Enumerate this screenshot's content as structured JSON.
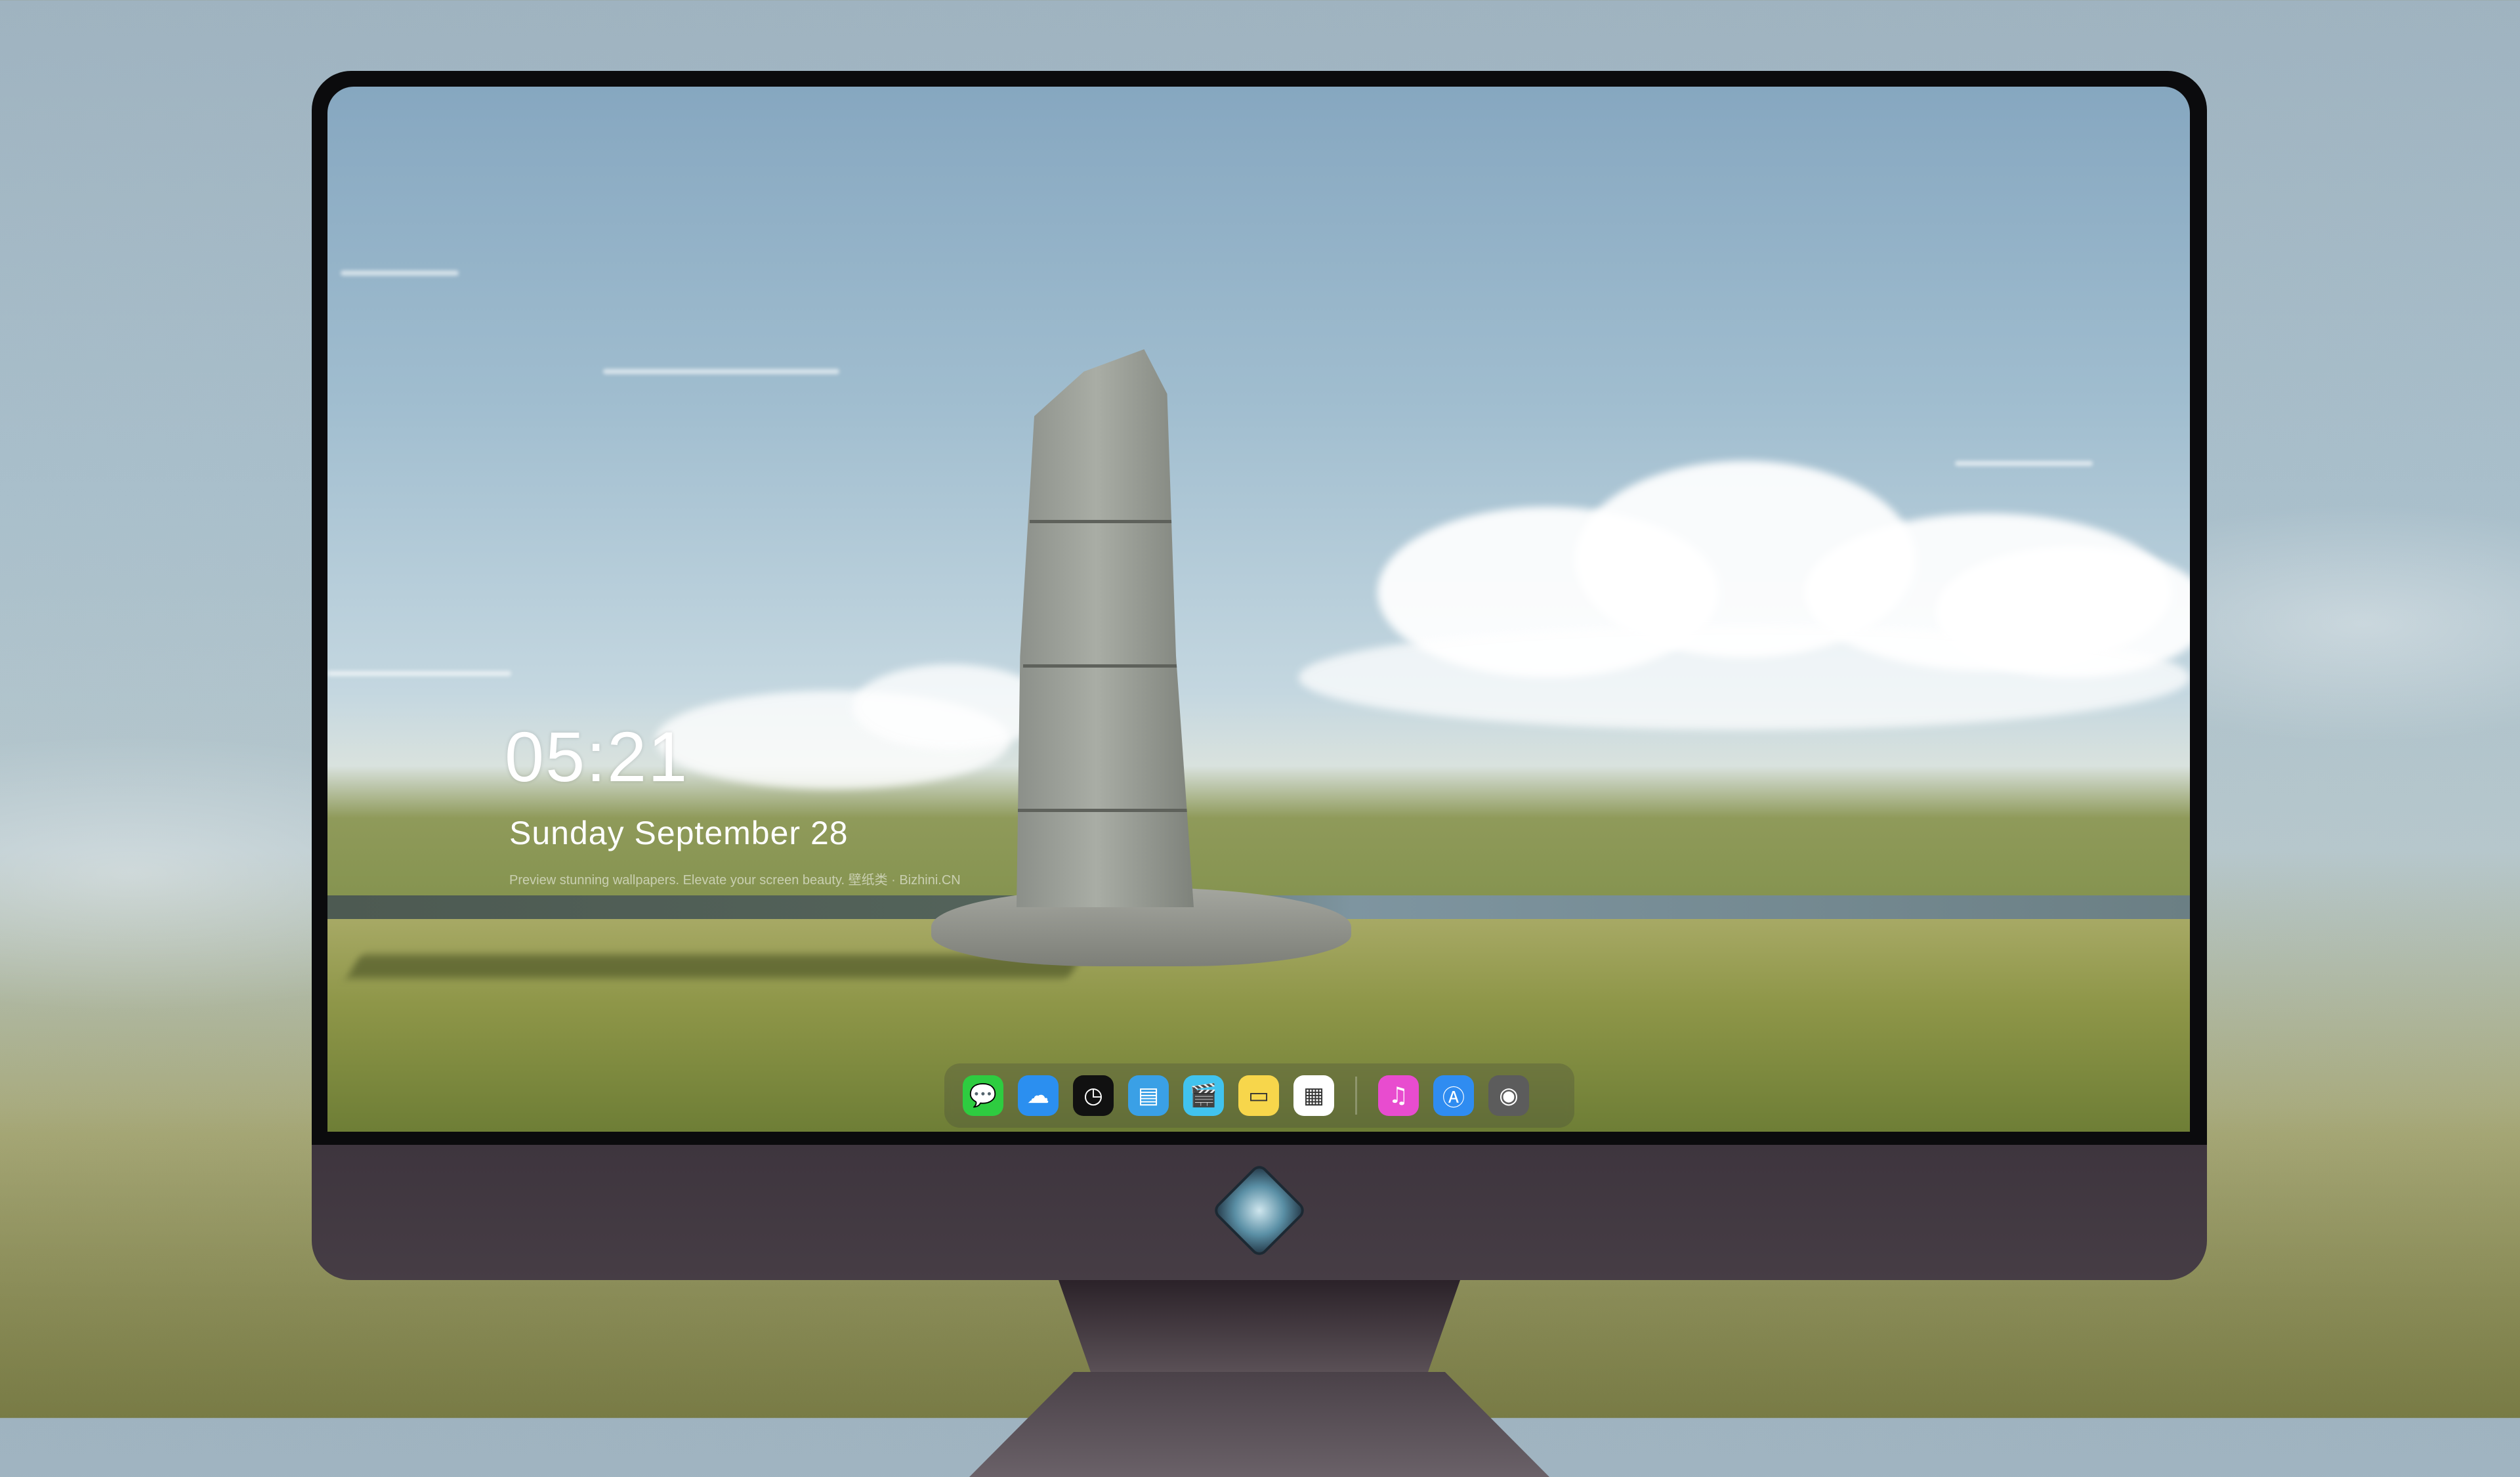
{
  "lockscreen": {
    "time": "05:21",
    "date": "Sunday September  28",
    "tagline": "Preview stunning wallpapers. Elevate your screen beauty. 壁纸类 · Bizhini.CN"
  },
  "dock": {
    "apps": [
      {
        "name": "messages-icon",
        "glyph": "💬",
        "color": "#2ecc40"
      },
      {
        "name": "weather-icon",
        "glyph": "☁",
        "color": "#2b8ff0"
      },
      {
        "name": "clock-icon",
        "glyph": "◷",
        "color": "#111111"
      },
      {
        "name": "preview-icon",
        "glyph": "▤",
        "color": "#3aa0e6"
      },
      {
        "name": "movie-clapper-icon",
        "glyph": "🎬",
        "color": "#41c3ee"
      },
      {
        "name": "notes-icon",
        "glyph": "▭",
        "color": "#f7d64b"
      },
      {
        "name": "calendar-icon",
        "glyph": "▦",
        "color": "#ffffff"
      },
      {
        "name": "music-icon",
        "glyph": "♫",
        "color": "#e84ccf"
      },
      {
        "name": "app-store-icon",
        "glyph": "Ⓐ",
        "color": "#2f8cf1"
      },
      {
        "name": "camera-icon",
        "glyph": "◉",
        "color": "#5c5c5c"
      }
    ]
  },
  "monitor": {
    "logo": "mascot-logo"
  }
}
